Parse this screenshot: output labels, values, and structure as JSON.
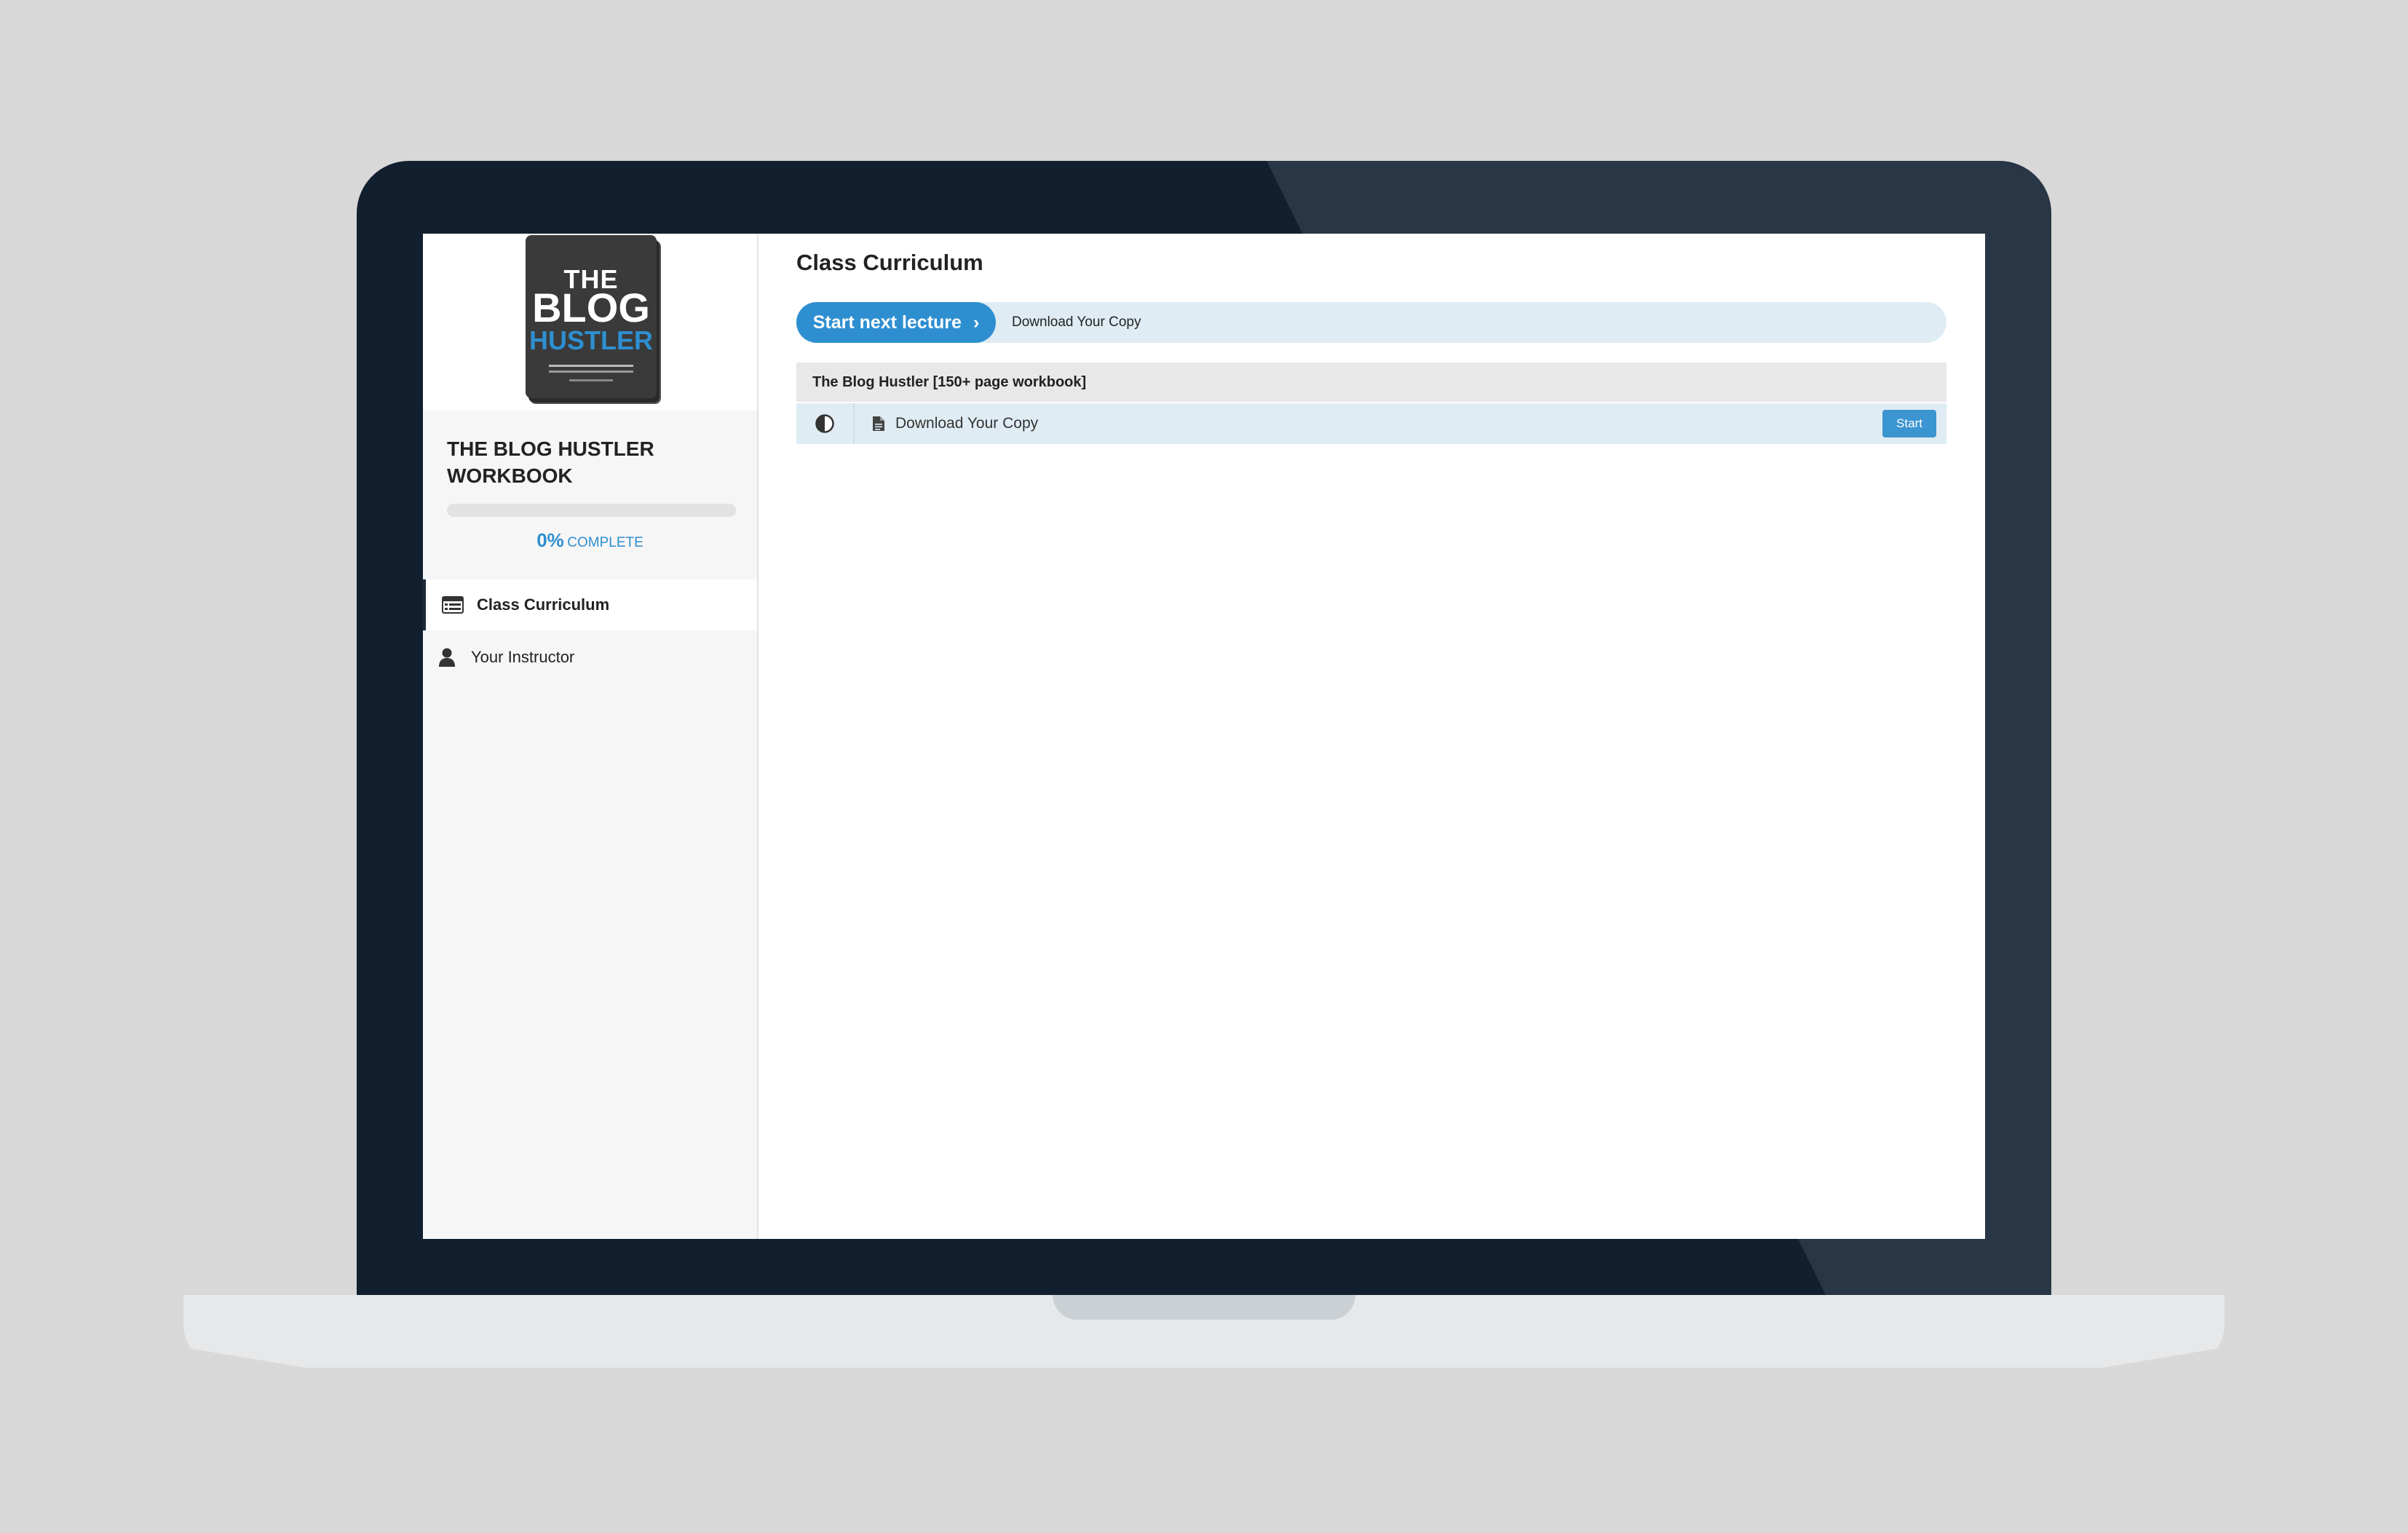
{
  "cover": {
    "line1": "THE",
    "line2": "BLOG",
    "line3": "HUSTLER",
    "colors": {
      "cover": "#3a3a3a",
      "accent": "#2e8fd0"
    }
  },
  "sidebar": {
    "course_title": "THE BLOG HUSTLER WORKBOOK",
    "progress": {
      "percent": 0,
      "percent_label": "0%",
      "label": "COMPLETE"
    },
    "nav": [
      {
        "label": "Class Curriculum",
        "icon": "curriculum-icon",
        "active": true
      },
      {
        "label": "Your Instructor",
        "icon": "user-icon",
        "active": false
      }
    ]
  },
  "main": {
    "title": "Class Curriculum",
    "next_lecture": {
      "button_label": "Start next lecture",
      "chevron": "›",
      "lecture_title": "Download Your Copy"
    },
    "sections": [
      {
        "title": "The Blog Hustler [150+ page workbook]",
        "lectures": [
          {
            "title": "Download Your Copy",
            "status_icon": "half-circle-icon",
            "type_icon": "document-icon",
            "action_label": "Start"
          }
        ]
      }
    ]
  },
  "theme": {
    "accent": "#2e8fd0",
    "row_bg": "#dfecf3",
    "laptop_frame": "#121f2e"
  }
}
